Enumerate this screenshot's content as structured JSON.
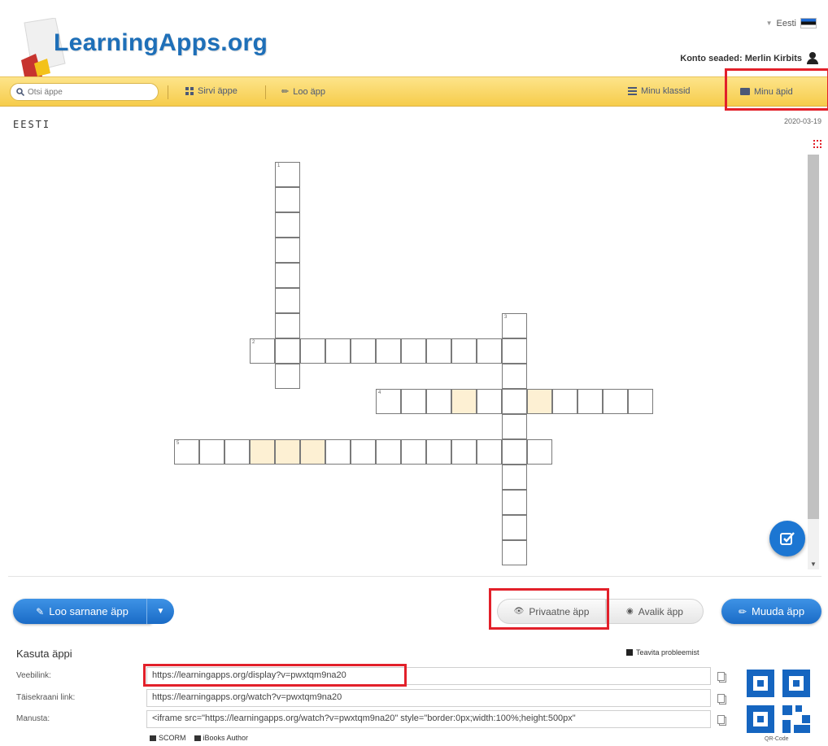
{
  "header": {
    "logo_text": "LearningApps.org",
    "language": "Eesti",
    "account_label": "Konto seaded: Merlin Kirbits"
  },
  "navbar": {
    "search_placeholder": "Otsi äppe",
    "browse_label": "Sirvi äppe",
    "create_label": "Loo äpp",
    "classes_label": "Minu klassid",
    "myapps_label": "Minu äpid"
  },
  "app": {
    "title": "EESTI",
    "date": "2020-03-19"
  },
  "crossword": {
    "clue_numbers": [
      "1",
      "2",
      "3",
      "4",
      "5"
    ]
  },
  "actions": {
    "similar_label": "Loo sarnane äpp",
    "private_label": "Privaatne äpp",
    "public_label": "Avalik äpp",
    "edit_label": "Muuda äpp"
  },
  "use_app": {
    "title": "Kasuta äppi",
    "report_label": "Teavita probleemist",
    "weblink_label": "Veebilink:",
    "weblink_value": "https://learningapps.org/display?v=pwxtqm9na20",
    "fullscreen_label": "Täisekraani link:",
    "fullscreen_value": "https://learningapps.org/watch?v=pwxtqm9na20",
    "embed_label": "Manusta:",
    "embed_value": "<iframe src=\"https://learningapps.org/watch?v=pwxtqm9na20\" style=\"border:0px;width:100%;height:500px\"",
    "scorm_label": "SCORM",
    "ibooks_label": "iBooks Author",
    "qr_label": "QR-Code"
  },
  "colors": {
    "navbar": "#f6cc4b",
    "logo": "#1e6fb8",
    "button_blue": "#1a6bc6",
    "highlight_box": "#e2202a",
    "highlight_cell": "#fdf0d3"
  }
}
